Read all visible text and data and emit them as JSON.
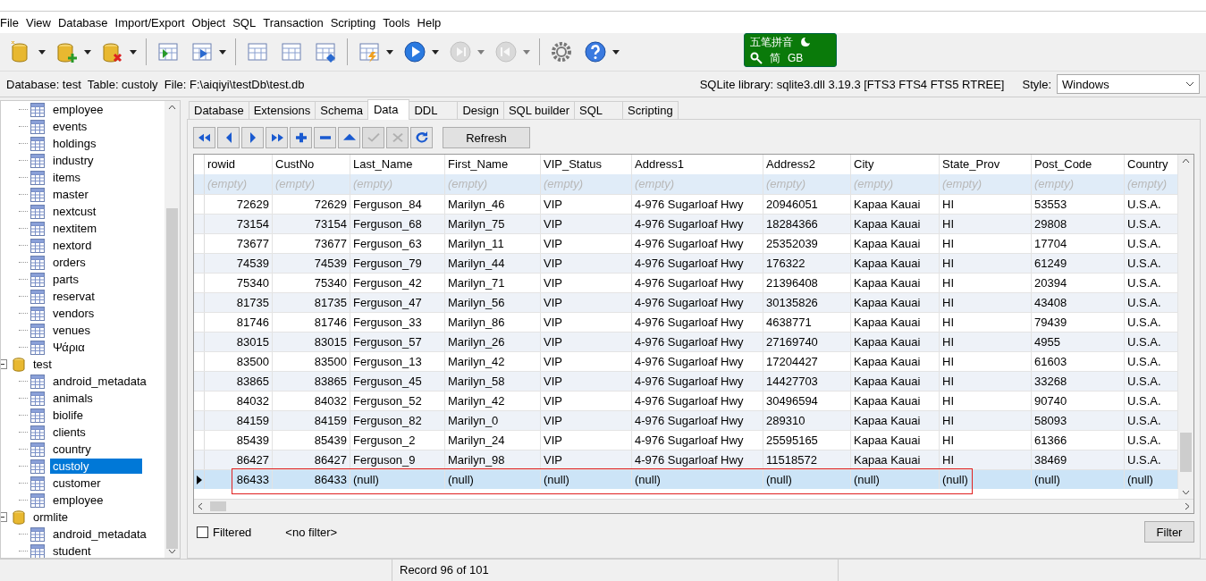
{
  "menu": [
    "File",
    "View",
    "Database",
    "Import/Export",
    "Object",
    "SQL",
    "Transaction",
    "Scripting",
    "Tools",
    "Help"
  ],
  "toolbar": [
    [
      {
        "dropdown": true,
        "disabled": false
      },
      {
        "dropdown": true,
        "disabled": false
      },
      {
        "dropdown": true,
        "disabled": false
      }
    ],
    [
      {
        "dropdown": false,
        "disabled": false
      },
      {
        "dropdown": true,
        "disabled": false
      }
    ],
    [
      {
        "dropdown": false,
        "disabled": false
      },
      {
        "dropdown": false,
        "disabled": false
      },
      {
        "dropdown": false,
        "disabled": false
      }
    ],
    [
      {
        "dropdown": true,
        "disabled": false
      },
      {
        "dropdown": true,
        "disabled": false
      },
      {
        "dropdown": true,
        "disabled": true
      },
      {
        "dropdown": true,
        "disabled": true
      }
    ],
    [
      {
        "dropdown": false,
        "disabled": false
      },
      {
        "dropdown": true,
        "disabled": false
      }
    ]
  ],
  "ime": {
    "name": "五笔拼音",
    "mode": "简",
    "charset": "GB"
  },
  "info": {
    "text": "Database: test  Table: custoly  File: F:\\aiqiyi\\testDb\\test.db",
    "library": "SQLite library: sqlite3.dll 3.19.3 [FTS3 FTS4 FTS5 RTREE]",
    "style_label": "Style:",
    "style_value": "Windows"
  },
  "tree": [
    {
      "children": [
        {
          "label": "employee"
        },
        {
          "label": "events"
        },
        {
          "label": "holdings"
        },
        {
          "label": "industry"
        },
        {
          "label": "items"
        },
        {
          "label": "master"
        },
        {
          "label": "nextcust"
        },
        {
          "label": "nextitem"
        },
        {
          "label": "nextord"
        },
        {
          "label": "orders"
        },
        {
          "label": "parts"
        },
        {
          "label": "reservat"
        },
        {
          "label": "vendors"
        },
        {
          "label": "venues"
        },
        {
          "label": "Ψάρια"
        }
      ]
    },
    {
      "label": "test",
      "expanded": true,
      "children": [
        {
          "label": "android_metadata",
          "selected": false
        },
        {
          "label": "animals",
          "selected": false
        },
        {
          "label": "biolife",
          "selected": false
        },
        {
          "label": "clients",
          "selected": false
        },
        {
          "label": "country",
          "selected": false
        },
        {
          "label": "custoly",
          "selected": true
        },
        {
          "label": "customer",
          "selected": false
        },
        {
          "label": "employee",
          "selected": false
        }
      ]
    },
    {
      "label": "ormlite",
      "expanded": true,
      "children": [
        {
          "label": "android_metadata",
          "selected": false
        },
        {
          "label": "student",
          "selected": false
        }
      ]
    }
  ],
  "tabs": [
    {
      "label": "Database",
      "selected": false
    },
    {
      "label": "Extensions",
      "selected": false
    },
    {
      "label": "Schema",
      "selected": false
    },
    {
      "label": "Data",
      "selected": true
    },
    {
      "label": "DDL",
      "selected": false
    },
    {
      "label": "Design",
      "selected": false
    },
    {
      "label": "SQL builder",
      "selected": false
    },
    {
      "label": "SQL",
      "selected": false
    },
    {
      "label": "Scripting",
      "selected": false
    }
  ],
  "navigator": [
    {
      "disabled": false
    },
    {
      "disabled": false
    },
    {
      "disabled": false
    },
    {
      "disabled": false
    },
    {
      "disabled": false
    },
    {
      "disabled": false
    },
    {
      "disabled": false
    },
    {
      "disabled": true
    },
    {
      "disabled": true
    },
    {
      "disabled": false
    }
  ],
  "refresh_button": "Refresh",
  "columns": [
    {
      "name": "rowid",
      "numeric": true
    },
    {
      "name": "CustNo",
      "numeric": true
    },
    {
      "name": "Last_Name",
      "numeric": false
    },
    {
      "name": "First_Name",
      "numeric": false
    },
    {
      "name": "VIP_Status",
      "numeric": false
    },
    {
      "name": "Address1",
      "numeric": false
    },
    {
      "name": "Address2",
      "numeric": false
    },
    {
      "name": "City",
      "numeric": false
    },
    {
      "name": "State_Prov",
      "numeric": false
    },
    {
      "name": "Post_Code",
      "numeric": false
    },
    {
      "name": "Country",
      "numeric": false
    }
  ],
  "filter_row": [
    "(empty)",
    "(empty)",
    "(empty)",
    "(empty)",
    "(empty)",
    "(empty)",
    "(empty)",
    "(empty)",
    "(empty)",
    "(empty)",
    "(empty)"
  ],
  "rows": [
    {
      "selected": false,
      "outlined": false,
      "cells": [
        "72629",
        "72629",
        "Ferguson_84",
        "Marilyn_46",
        "VIP",
        "4-976 Sugarloaf Hwy",
        "20946051",
        "Kapaa Kauai",
        "HI",
        "53553",
        "U.S.A."
      ]
    },
    {
      "selected": false,
      "outlined": false,
      "cells": [
        "73154",
        "73154",
        "Ferguson_68",
        "Marilyn_75",
        "VIP",
        "4-976 Sugarloaf Hwy",
        "18284366",
        "Kapaa Kauai",
        "HI",
        "29808",
        "U.S.A."
      ]
    },
    {
      "selected": false,
      "outlined": false,
      "cells": [
        "73677",
        "73677",
        "Ferguson_63",
        "Marilyn_11",
        "VIP",
        "4-976 Sugarloaf Hwy",
        "25352039",
        "Kapaa Kauai",
        "HI",
        "17704",
        "U.S.A."
      ]
    },
    {
      "selected": false,
      "outlined": false,
      "cells": [
        "74539",
        "74539",
        "Ferguson_79",
        "Marilyn_44",
        "VIP",
        "4-976 Sugarloaf Hwy",
        "176322",
        "Kapaa Kauai",
        "HI",
        "61249",
        "U.S.A."
      ]
    },
    {
      "selected": false,
      "outlined": false,
      "cells": [
        "75340",
        "75340",
        "Ferguson_42",
        "Marilyn_71",
        "VIP",
        "4-976 Sugarloaf Hwy",
        "21396408",
        "Kapaa Kauai",
        "HI",
        "20394",
        "U.S.A."
      ]
    },
    {
      "selected": false,
      "outlined": false,
      "cells": [
        "81735",
        "81735",
        "Ferguson_47",
        "Marilyn_56",
        "VIP",
        "4-976 Sugarloaf Hwy",
        "30135826",
        "Kapaa Kauai",
        "HI",
        "43408",
        "U.S.A."
      ]
    },
    {
      "selected": false,
      "outlined": false,
      "cells": [
        "81746",
        "81746",
        "Ferguson_33",
        "Marilyn_86",
        "VIP",
        "4-976 Sugarloaf Hwy",
        "4638771",
        "Kapaa Kauai",
        "HI",
        "79439",
        "U.S.A."
      ]
    },
    {
      "selected": false,
      "outlined": false,
      "cells": [
        "83015",
        "83015",
        "Ferguson_57",
        "Marilyn_26",
        "VIP",
        "4-976 Sugarloaf Hwy",
        "27169740",
        "Kapaa Kauai",
        "HI",
        "4955",
        "U.S.A."
      ]
    },
    {
      "selected": false,
      "outlined": false,
      "cells": [
        "83500",
        "83500",
        "Ferguson_13",
        "Marilyn_42",
        "VIP",
        "4-976 Sugarloaf Hwy",
        "17204427",
        "Kapaa Kauai",
        "HI",
        "61603",
        "U.S.A."
      ]
    },
    {
      "selected": false,
      "outlined": false,
      "cells": [
        "83865",
        "83865",
        "Ferguson_45",
        "Marilyn_58",
        "VIP",
        "4-976 Sugarloaf Hwy",
        "14427703",
        "Kapaa Kauai",
        "HI",
        "33268",
        "U.S.A."
      ]
    },
    {
      "selected": false,
      "outlined": false,
      "cells": [
        "84032",
        "84032",
        "Ferguson_52",
        "Marilyn_42",
        "VIP",
        "4-976 Sugarloaf Hwy",
        "30496594",
        "Kapaa Kauai",
        "HI",
        "90740",
        "U.S.A."
      ]
    },
    {
      "selected": false,
      "outlined": false,
      "cells": [
        "84159",
        "84159",
        "Ferguson_82",
        "Marilyn_0",
        "VIP",
        "4-976 Sugarloaf Hwy",
        "289310",
        "Kapaa Kauai",
        "HI",
        "58093",
        "U.S.A."
      ]
    },
    {
      "selected": false,
      "outlined": false,
      "cells": [
        "85439",
        "85439",
        "Ferguson_2",
        "Marilyn_24",
        "VIP",
        "4-976 Sugarloaf Hwy",
        "25595165",
        "Kapaa Kauai",
        "HI",
        "61366",
        "U.S.A."
      ]
    },
    {
      "selected": false,
      "outlined": false,
      "cells": [
        "86427",
        "86427",
        "Ferguson_9",
        "Marilyn_98",
        "VIP",
        "4-976 Sugarloaf Hwy",
        "11518572",
        "Kapaa Kauai",
        "HI",
        "38469",
        "U.S.A."
      ]
    },
    {
      "selected": true,
      "outlined": true,
      "cells": [
        "86433",
        "86433",
        "(null)",
        "(null)",
        "(null)",
        "(null)",
        "(null)",
        "(null)",
        "(null)",
        "(null)",
        "(null)"
      ]
    }
  ],
  "filter": {
    "label": "Filtered",
    "checked": false,
    "text": "<no filter>",
    "button": "Filter"
  },
  "status_bar": {
    "record": "Record 96 of 101"
  }
}
